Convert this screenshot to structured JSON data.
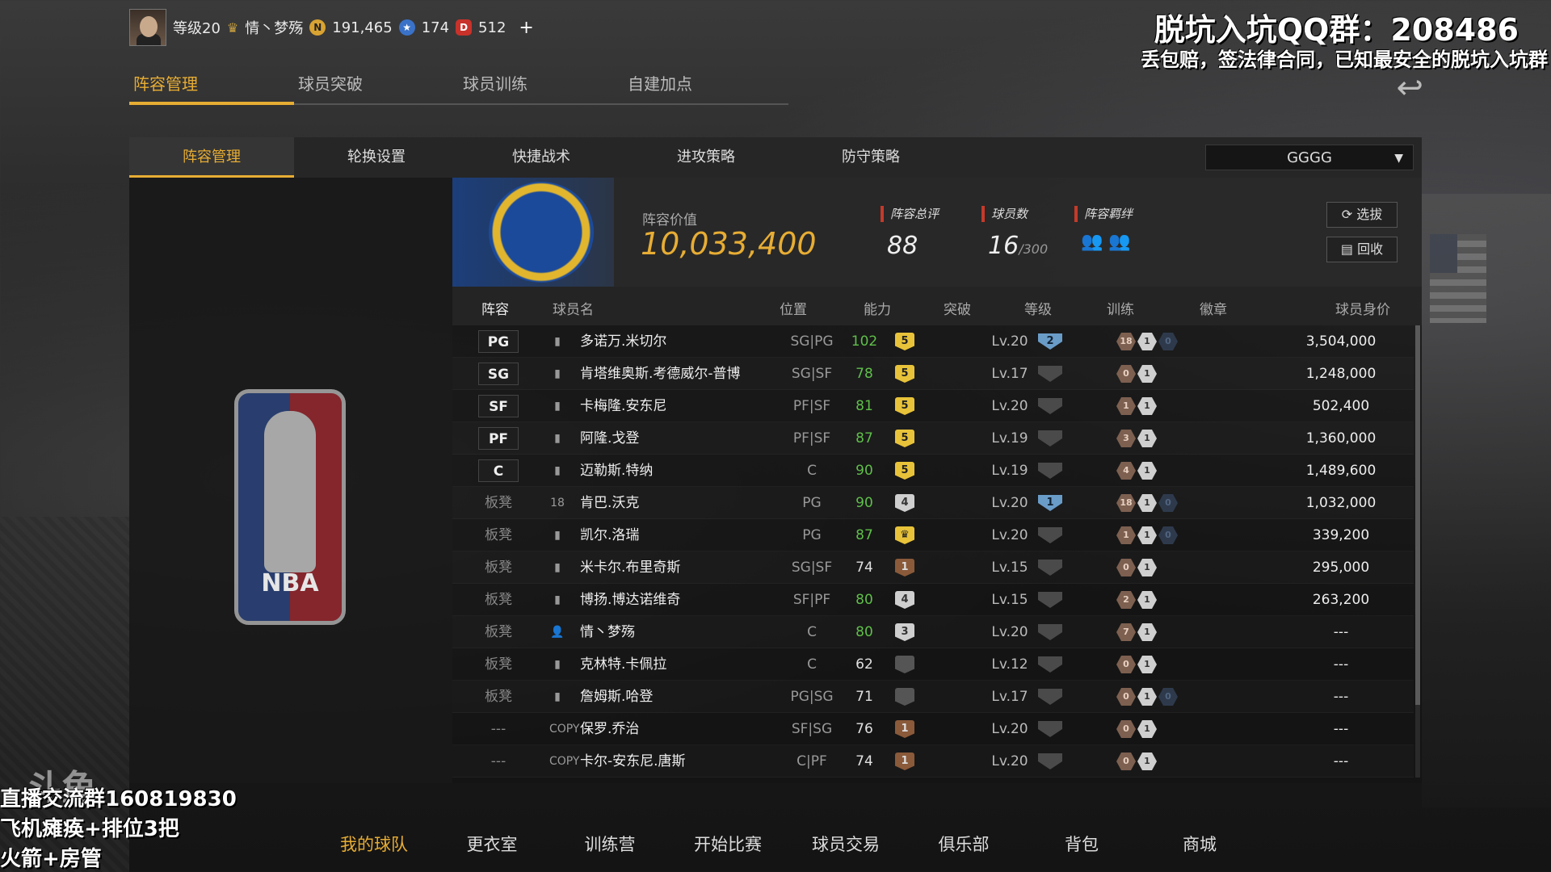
{
  "profile": {
    "level": "等级20",
    "name": "情丶梦殇",
    "gold": "191,465",
    "stars": "174",
    "tickets": "512",
    "plus": "+"
  },
  "overlay": {
    "qq_title": "脱坑入坑QQ群：208486",
    "qq_sub": "丢包赔，签法律合同，已知最安全的脱坑入坑群",
    "watermark": "斗鱼",
    "line1": "直播交流群160819830",
    "line2": "飞机瘫痪+排位3把",
    "line3": "火箭+房管"
  },
  "main_tabs": [
    "阵容管理",
    "球员突破",
    "球员训练",
    "自建加点"
  ],
  "sub_tabs": [
    "阵容管理",
    "轮换设置",
    "快捷战术",
    "进攻策略",
    "防守策略"
  ],
  "lineup_select": "GGGG",
  "team": {
    "value_label": "阵容价值",
    "value": "10,033,400",
    "overall_label": "阵容总评",
    "overall": "88",
    "players_label": "球员数",
    "players": "16",
    "players_max": "/300",
    "chem_label": "阵容羁绊",
    "btn_draft": "选拔",
    "btn_recycle": "回收"
  },
  "table": {
    "headers": [
      "阵容",
      "球员名",
      "位置",
      "能力",
      "突破",
      "等级",
      "训练",
      "徽章",
      "球员身价"
    ],
    "rows": [
      {
        "slot": "PG",
        "starter": true,
        "icon": "bars",
        "name": "多诺万.米切尔",
        "pos": "SG|PG",
        "ability": "102",
        "ab": "g",
        "brk": "5",
        "bc": "y",
        "level": "Lv.20",
        "train": "2",
        "tc": "b",
        "badges": [
          [
            "18",
            "br"
          ],
          [
            "1",
            "sv"
          ],
          [
            "0",
            "bl"
          ]
        ],
        "price": "3,504,000"
      },
      {
        "slot": "SG",
        "starter": true,
        "icon": "bars",
        "name": "肯塔维奥斯.考德威尔-普博",
        "pos": "SG|SF",
        "ability": "78",
        "ab": "g",
        "brk": "5",
        "bc": "y",
        "level": "Lv.17",
        "train": "",
        "tc": "n",
        "badges": [
          [
            "0",
            "br"
          ],
          [
            "1",
            "sv"
          ]
        ],
        "price": "1,248,000"
      },
      {
        "slot": "SF",
        "starter": true,
        "icon": "bars",
        "name": "卡梅隆.安东尼",
        "pos": "PF|SF",
        "ability": "81",
        "ab": "g",
        "brk": "5",
        "bc": "y",
        "level": "Lv.20",
        "train": "",
        "tc": "n",
        "badges": [
          [
            "1",
            "br"
          ],
          [
            "1",
            "sv"
          ]
        ],
        "price": "502,400"
      },
      {
        "slot": "PF",
        "starter": true,
        "icon": "bars",
        "name": "阿隆.戈登",
        "pos": "PF|SF",
        "ability": "87",
        "ab": "g",
        "brk": "5",
        "bc": "y",
        "level": "Lv.19",
        "train": "",
        "tc": "n",
        "badges": [
          [
            "3",
            "br"
          ],
          [
            "1",
            "sv"
          ]
        ],
        "price": "1,360,000"
      },
      {
        "slot": "C",
        "starter": true,
        "icon": "bars",
        "name": "迈勒斯.特纳",
        "pos": "C",
        "ability": "90",
        "ab": "g",
        "brk": "5",
        "bc": "y",
        "level": "Lv.19",
        "train": "",
        "tc": "n",
        "badges": [
          [
            "4",
            "br"
          ],
          [
            "1",
            "sv"
          ]
        ],
        "price": "1,489,600"
      },
      {
        "slot": "板凳",
        "starter": false,
        "icon": "18",
        "name": "肯巴.沃克",
        "pos": "PG",
        "ability": "90",
        "ab": "g",
        "brk": "4",
        "bc": "s",
        "level": "Lv.20",
        "train": "1",
        "tc": "b",
        "badges": [
          [
            "18",
            "br"
          ],
          [
            "1",
            "sv"
          ],
          [
            "0",
            "bl"
          ]
        ],
        "price": "1,032,000"
      },
      {
        "slot": "板凳",
        "starter": false,
        "icon": "bars",
        "name": "凯尔.洛瑞",
        "pos": "PG",
        "ability": "87",
        "ab": "g",
        "brk": "♛",
        "bc": "y",
        "level": "Lv.20",
        "train": "",
        "tc": "n",
        "badges": [
          [
            "1",
            "br"
          ],
          [
            "1",
            "sv"
          ],
          [
            "0",
            "bl"
          ]
        ],
        "price": "339,200"
      },
      {
        "slot": "板凳",
        "starter": false,
        "icon": "bars",
        "name": "米卡尔.布里奇斯",
        "pos": "SG|SF",
        "ability": "74",
        "ab": "w",
        "brk": "1",
        "bc": "b",
        "level": "Lv.15",
        "train": "",
        "tc": "n",
        "badges": [
          [
            "0",
            "br"
          ],
          [
            "1",
            "sv"
          ]
        ],
        "price": "295,000"
      },
      {
        "slot": "板凳",
        "starter": false,
        "icon": "bars",
        "name": "博扬.博达诺维奇",
        "pos": "SF|PF",
        "ability": "80",
        "ab": "g",
        "brk": "4",
        "bc": "s",
        "level": "Lv.15",
        "train": "",
        "tc": "n",
        "badges": [
          [
            "2",
            "br"
          ],
          [
            "1",
            "sv"
          ]
        ],
        "price": "263,200"
      },
      {
        "slot": "板凳",
        "starter": false,
        "icon": "person",
        "name": "情丶梦殇",
        "pos": "C",
        "ability": "80",
        "ab": "g",
        "brk": "3",
        "bc": "s",
        "level": "Lv.20",
        "train": "",
        "tc": "n",
        "badges": [
          [
            "7",
            "br"
          ],
          [
            "1",
            "sv"
          ]
        ],
        "price": "---"
      },
      {
        "slot": "板凳",
        "starter": false,
        "icon": "bars",
        "name": "克林特.卡佩拉",
        "pos": "C",
        "ability": "62",
        "ab": "w",
        "brk": "",
        "bc": "n",
        "level": "Lv.12",
        "train": "",
        "tc": "n",
        "badges": [
          [
            "0",
            "br"
          ],
          [
            "1",
            "sv"
          ]
        ],
        "price": "---"
      },
      {
        "slot": "板凳",
        "starter": false,
        "icon": "bars",
        "name": "詹姆斯.哈登",
        "pos": "PG|SG",
        "ability": "71",
        "ab": "w",
        "brk": "",
        "bc": "n",
        "level": "Lv.17",
        "train": "",
        "tc": "n",
        "badges": [
          [
            "0",
            "br"
          ],
          [
            "1",
            "sv"
          ],
          [
            "0",
            "bl"
          ]
        ],
        "price": "---"
      },
      {
        "slot": "---",
        "starter": false,
        "icon": "COPY",
        "name": "保罗.乔治",
        "pos": "SF|SG",
        "ability": "76",
        "ab": "w",
        "brk": "1",
        "bc": "b",
        "level": "Lv.20",
        "train": "",
        "tc": "n",
        "badges": [
          [
            "0",
            "br"
          ],
          [
            "1",
            "sv"
          ]
        ],
        "price": "---"
      },
      {
        "slot": "---",
        "starter": false,
        "icon": "COPY",
        "name": "卡尔-安东尼.唐斯",
        "pos": "C|PF",
        "ability": "74",
        "ab": "w",
        "brk": "1",
        "bc": "b",
        "level": "Lv.20",
        "train": "",
        "tc": "n",
        "badges": [
          [
            "0",
            "br"
          ],
          [
            "1",
            "sv"
          ]
        ],
        "price": "---"
      }
    ]
  },
  "bottom_nav": [
    "我的球队",
    "更衣室",
    "训练营",
    "开始比赛",
    "球员交易",
    "俱乐部",
    "背包",
    "商城"
  ],
  "logo_text": "NBA",
  "colors": {
    "accent": "#e7ad34",
    "ability_green": "#5fbf4a"
  }
}
